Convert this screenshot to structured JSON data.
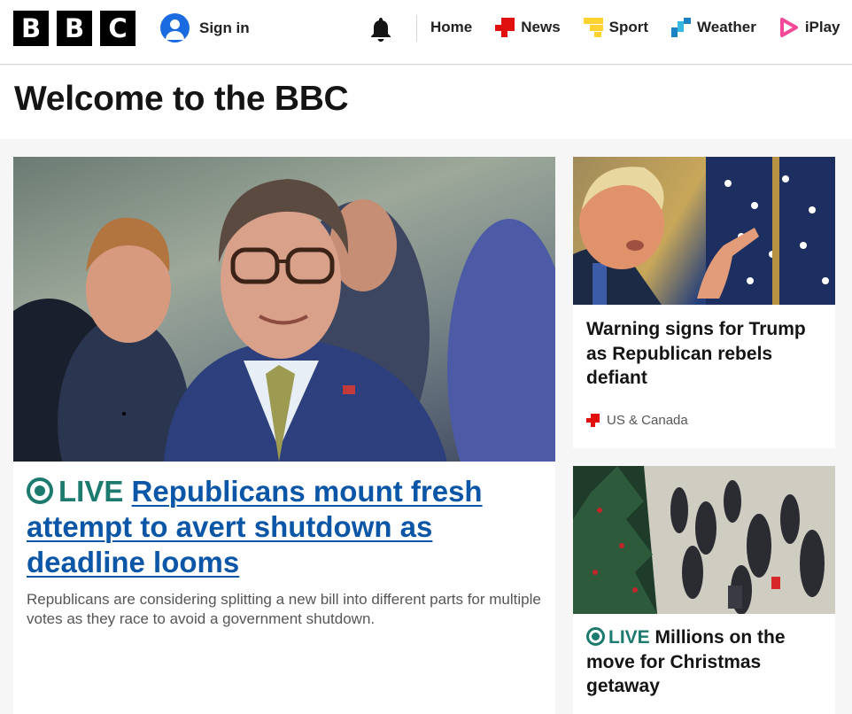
{
  "header": {
    "logo_letters": [
      "B",
      "B",
      "C"
    ],
    "sign_in_label": "Sign in",
    "notifications_icon": "bell-icon",
    "nav": [
      {
        "label": "Home",
        "icon": ""
      },
      {
        "label": "News",
        "icon": "news-icon",
        "color": "#e01010"
      },
      {
        "label": "Sport",
        "icon": "sport-icon",
        "color": "#ffd230"
      },
      {
        "label": "Weather",
        "icon": "weather-icon",
        "color": "#1b82c4"
      },
      {
        "label": "iPlay",
        "icon": "iplayer-icon",
        "color": "#f54997"
      }
    ]
  },
  "welcome": {
    "title": "Welcome to the BBC"
  },
  "main_story": {
    "live_label": "LIVE",
    "headline": "Republicans mount fresh attempt to avert shutdown as deadline looms",
    "summary": "Republicans are considering splitting a new bill into different parts for multiple votes as they race to avoid a government shutdown."
  },
  "side_stories": [
    {
      "headline": "Warning signs for Trump as Republican rebels defiant",
      "tag": "US & Canada"
    },
    {
      "live_label": "LIVE",
      "headline": "Millions on the move for Christmas getaway"
    }
  ],
  "colors": {
    "live": "#1d7a6e",
    "link": "#0b56a6",
    "news_red": "#e01010"
  }
}
